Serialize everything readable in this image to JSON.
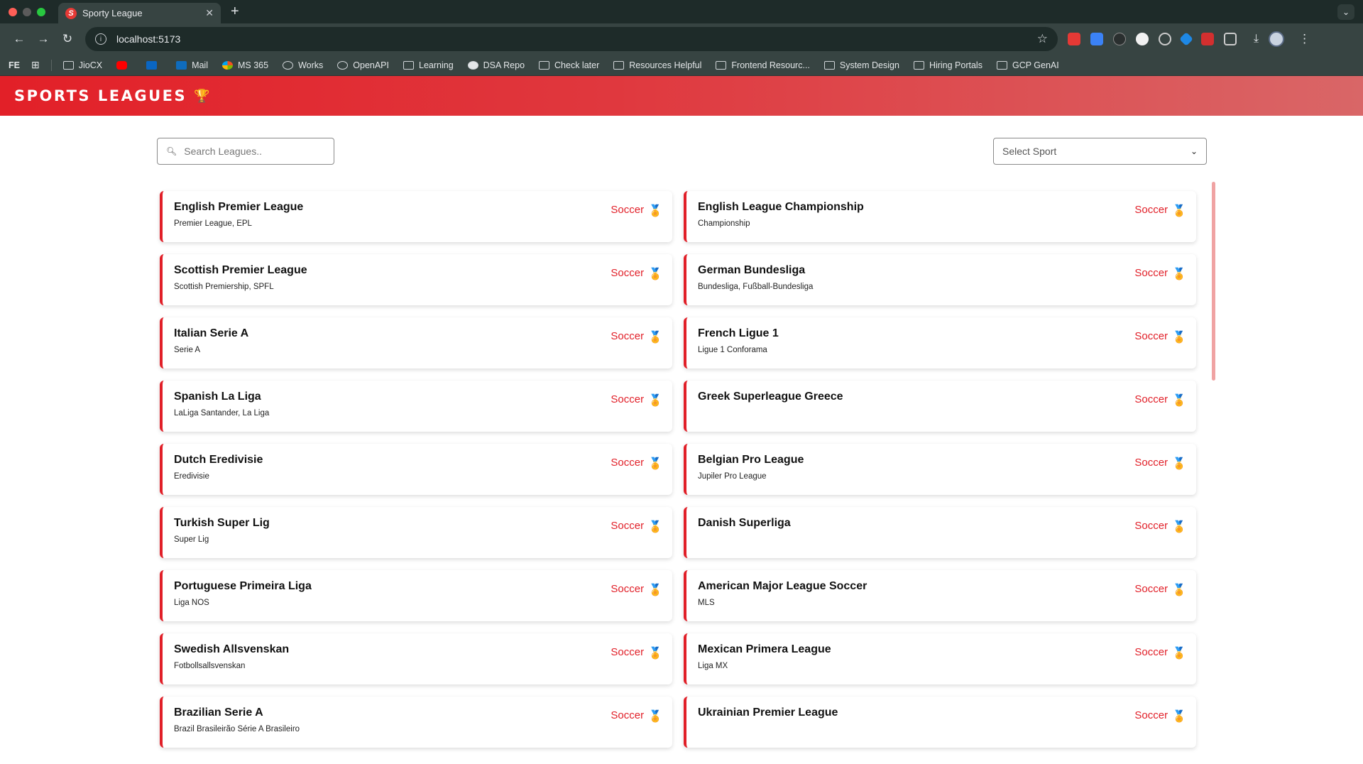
{
  "browser": {
    "tab_title": "Sporty League",
    "tab_favicon": "S",
    "url": "localhost:5173",
    "bookmarks_prefix": "FE",
    "bookmarks": [
      {
        "label": "JioCX",
        "icon": "folder-icon"
      },
      {
        "label": "",
        "icon": "youtube-icon"
      },
      {
        "label": "",
        "icon": "linkedin-icon"
      },
      {
        "label": "Mail",
        "icon": "outlook-icon"
      },
      {
        "label": "MS 365",
        "icon": "ms365-icon"
      },
      {
        "label": "Works",
        "icon": "works-icon"
      },
      {
        "label": "OpenAPI",
        "icon": "openai-icon"
      },
      {
        "label": "Learning",
        "icon": "folder-icon"
      },
      {
        "label": "DSA Repo",
        "icon": "github-icon"
      },
      {
        "label": "Check later",
        "icon": "folder-icon"
      },
      {
        "label": "Resources Helpful",
        "icon": "folder-icon"
      },
      {
        "label": "Frontend Resourc...",
        "icon": "folder-icon"
      },
      {
        "label": "System Design",
        "icon": "folder-icon"
      },
      {
        "label": "Hiring Portals",
        "icon": "folder-icon"
      },
      {
        "label": "GCP GenAI",
        "icon": "folder-icon"
      }
    ]
  },
  "app": {
    "brand": "SPORTS LEAGUES",
    "brand_icon": "🏆",
    "accent_color": "#e11f28",
    "search": {
      "placeholder": "Search Leagues.."
    },
    "sport_select": {
      "value": "Select Sport"
    },
    "leagues": [
      {
        "name": "English Premier League",
        "alternate": "Premier League, EPL",
        "sport": "Soccer"
      },
      {
        "name": "English League Championship",
        "alternate": "Championship",
        "sport": "Soccer"
      },
      {
        "name": "Scottish Premier League",
        "alternate": "Scottish Premiership, SPFL",
        "sport": "Soccer"
      },
      {
        "name": "German Bundesliga",
        "alternate": "Bundesliga, Fußball-Bundesliga",
        "sport": "Soccer"
      },
      {
        "name": "Italian Serie A",
        "alternate": "Serie A",
        "sport": "Soccer"
      },
      {
        "name": "French Ligue 1",
        "alternate": "Ligue 1 Conforama",
        "sport": "Soccer"
      },
      {
        "name": "Spanish La Liga",
        "alternate": "LaLiga Santander, La Liga",
        "sport": "Soccer"
      },
      {
        "name": "Greek Superleague Greece",
        "alternate": "",
        "sport": "Soccer"
      },
      {
        "name": "Dutch Eredivisie",
        "alternate": "Eredivisie",
        "sport": "Soccer"
      },
      {
        "name": "Belgian Pro League",
        "alternate": "Jupiler Pro League",
        "sport": "Soccer"
      },
      {
        "name": "Turkish Super Lig",
        "alternate": "Super Lig",
        "sport": "Soccer"
      },
      {
        "name": "Danish Superliga",
        "alternate": "",
        "sport": "Soccer"
      },
      {
        "name": "Portuguese Primeira Liga",
        "alternate": "Liga NOS",
        "sport": "Soccer"
      },
      {
        "name": "American Major League Soccer",
        "alternate": "MLS",
        "sport": "Soccer"
      },
      {
        "name": "Swedish Allsvenskan",
        "alternate": "Fotbollsallsvenskan",
        "sport": "Soccer"
      },
      {
        "name": "Mexican Primera League",
        "alternate": "Liga MX",
        "sport": "Soccer"
      },
      {
        "name": "Brazilian Serie A",
        "alternate": "Brazil Brasileirão Série A Brasileiro",
        "sport": "Soccer"
      },
      {
        "name": "Ukrainian Premier League",
        "alternate": "",
        "sport": "Soccer"
      }
    ]
  }
}
